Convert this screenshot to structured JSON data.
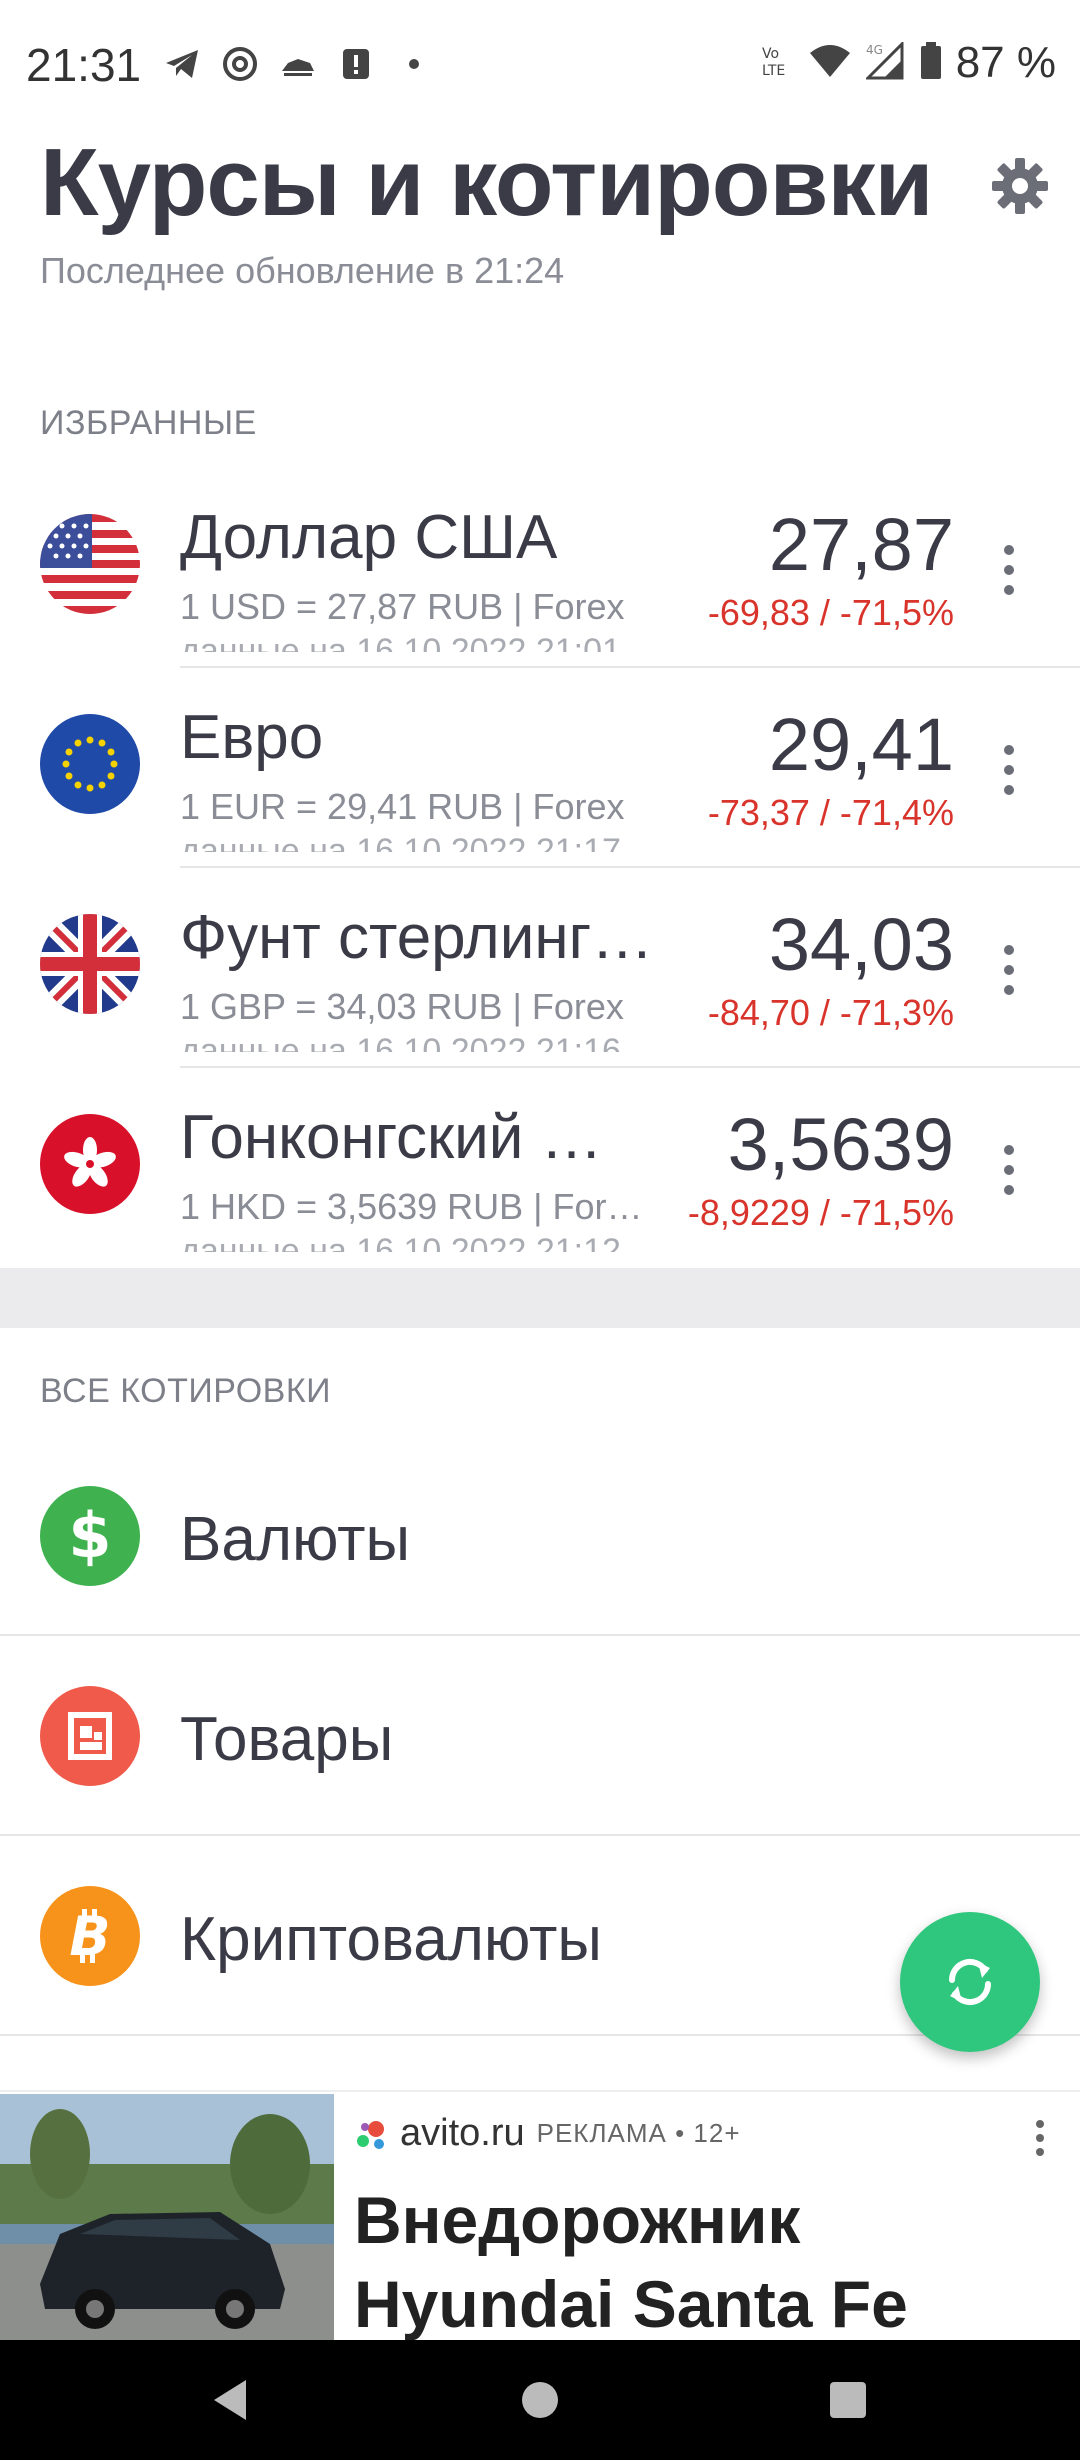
{
  "status_bar": {
    "time": "21:31",
    "battery": "87 %",
    "icons": [
      "telegram-icon",
      "at-icon",
      "pod-icon",
      "alert-icon",
      "dot-icon",
      "volte-icon",
      "wifi-icon",
      "signal-icon",
      "battery-icon"
    ]
  },
  "header": {
    "title": "Курсы и котировки",
    "subtitle": "Последнее обновление в 21:24"
  },
  "favorites": {
    "label": "ИЗБРАННЫЕ",
    "items": [
      {
        "name": "Доллар США",
        "desc": "1 USD = 27,87 RUB | Forex",
        "date": "данные на 16.10.2022 21:01",
        "price": "27,87",
        "change": "-69,83 / -71,5%",
        "flag": "us-flag-icon"
      },
      {
        "name": "Евро",
        "desc": "1 EUR = 29,41 RUB | Forex",
        "date": "данные на 16.10.2022 21:17",
        "price": "29,41",
        "change": "-73,37 / -71,4%",
        "flag": "eu-flag-icon"
      },
      {
        "name": "Фунт стерлинг…",
        "desc": "1 GBP = 34,03 RUB | Forex",
        "date": "данные на 16.10.2022 21:16",
        "price": "34,03",
        "change": "-84,70 / -71,3%",
        "flag": "uk-flag-icon"
      },
      {
        "name": "Гонконгский …",
        "desc": "1 HKD = 3,5639 RUB | For…",
        "date": "данные на 16.10.2022 21:12",
        "price": "3,5639",
        "change": "-8,9229 / -71,5%",
        "flag": "hk-flag-icon"
      }
    ]
  },
  "all_quotes": {
    "label": "ВСЕ КОТИРОВКИ",
    "items": [
      {
        "label": "Валюты",
        "icon": "dollar-icon",
        "color": "#3fb24f"
      },
      {
        "label": "Товары",
        "icon": "goods-icon",
        "color": "#f05a4a"
      },
      {
        "label": "Криптовалюты",
        "icon": "bitcoin-icon",
        "color": "#f7931a"
      }
    ]
  },
  "ad": {
    "site": "avito.ru",
    "tag": "РЕКЛАМА • 12+",
    "title": "Внедорожник Hyundai Santa Fe"
  },
  "colors": {
    "negative": "#d9342b",
    "fab": "#2fc77d",
    "text": "#3a3b46"
  }
}
